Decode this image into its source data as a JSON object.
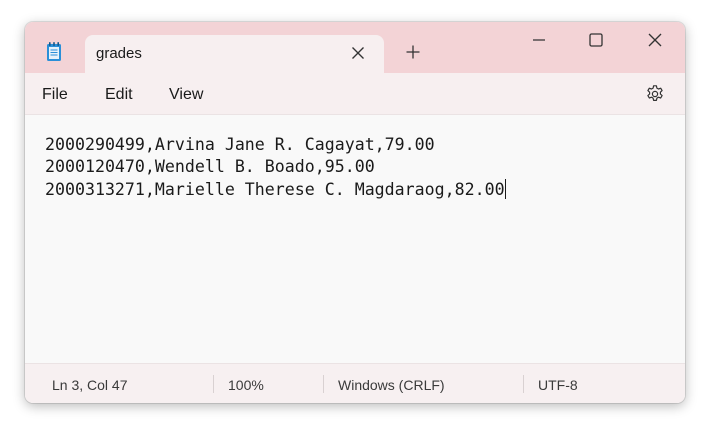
{
  "tab": {
    "title": "grades"
  },
  "menu": {
    "file": "File",
    "edit": "Edit",
    "view": "View"
  },
  "editor": {
    "lines": [
      "2000290499,Arvina Jane R. Cagayat,79.00",
      "2000120470,Wendell B. Boado,95.00",
      "2000313271,Marielle Therese C. Magdaraog,82.00"
    ]
  },
  "status": {
    "position": "Ln 3, Col 47",
    "zoom": "100%",
    "line_ending": "Windows (CRLF)",
    "encoding": "UTF-8"
  },
  "icons": {
    "app": "notepad-icon",
    "tab_close": "close-icon",
    "new_tab": "plus-icon",
    "minimize": "minimize-icon",
    "maximize": "maximize-icon",
    "close": "close-icon",
    "settings": "gear-icon"
  },
  "colors": {
    "titlebar": "#f3d3d6",
    "tab": "#f7eff0",
    "editor_bg": "#f9f9f9",
    "app_icon": "#2a8fd8"
  }
}
